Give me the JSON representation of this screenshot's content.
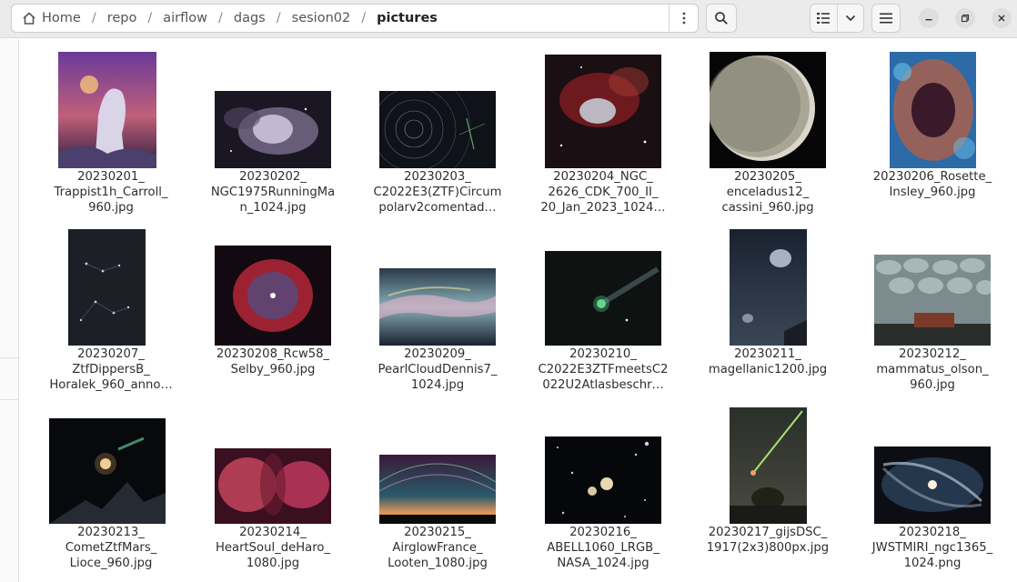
{
  "window": {
    "breadcrumbs": [
      "Home",
      "repo",
      "airflow",
      "dags",
      "sesion02",
      "pictures"
    ],
    "separator": "/"
  },
  "icons": {
    "home": "home-icon",
    "path_menu": "vertical-ellipsis-icon",
    "search": "search-icon",
    "view": "list-view-icon",
    "view_dropdown": "chevron-down-icon",
    "menu": "hamburger-menu-icon",
    "minimize": "minimize-icon",
    "maximize": "maximize-icon",
    "close": "close-icon"
  },
  "files": [
    {
      "name": "20230201_\nTrappist1h_Carroll_\n960.jpg",
      "thumb": "trappist"
    },
    {
      "name": "20230202_\nNGC1975RunningMa\nn_1024.jpg",
      "thumb": "runningman"
    },
    {
      "name": "20230203_\nC2022E3(ZTF)Circum\npolarv2comentad…",
      "thumb": "circumpolar"
    },
    {
      "name": "20230204_NGC_\n2626_CDK_700_II_\n20_Jan_2023_1024…",
      "thumb": "ngc2626"
    },
    {
      "name": "20230205_\nenceladus12_\ncassini_960.jpg",
      "thumb": "enceladus"
    },
    {
      "name": "20230206_Rosette_\nInsley_960.jpg",
      "thumb": "rosette"
    },
    {
      "name": "20230207_\nZtfDippersB_\nHoralek_960_anno…",
      "thumb": "dippers"
    },
    {
      "name": "20230208_Rcw58_\nSelby_960.jpg",
      "thumb": "rcw58"
    },
    {
      "name": "20230209_\nPearlCloudDennis7_\n1024.jpg",
      "thumb": "pearlcloud"
    },
    {
      "name": "20230210_\nC2022E3ZTFmeetsC2\n022U2Atlasbeschr…",
      "thumb": "cometmeets"
    },
    {
      "name": "20230211_\nmagellanic1200.jpg",
      "thumb": "magellanic"
    },
    {
      "name": "20230212_\nmammatus_olson_\n960.jpg",
      "thumb": "mammatus"
    },
    {
      "name": "20230213_\nCometZtfMars_\nLioce_960.jpg",
      "thumb": "cometmars"
    },
    {
      "name": "20230214_\nHeartSoul_deHaro_\n1080.jpg",
      "thumb": "heartsoul"
    },
    {
      "name": "20230215_\nAirglowFrance_\nLooten_1080.jpg",
      "thumb": "airglow"
    },
    {
      "name": "20230216_\nABELL1060_LRGB_\nNASA_1024.jpg",
      "thumb": "abell"
    },
    {
      "name": "20230217_gijsDSC_\n1917(2x3)800px.jpg",
      "thumb": "meteor"
    },
    {
      "name": "20230218_\nJWSTMIRI_ngc1365_\n1024.png",
      "thumb": "jwst"
    }
  ]
}
